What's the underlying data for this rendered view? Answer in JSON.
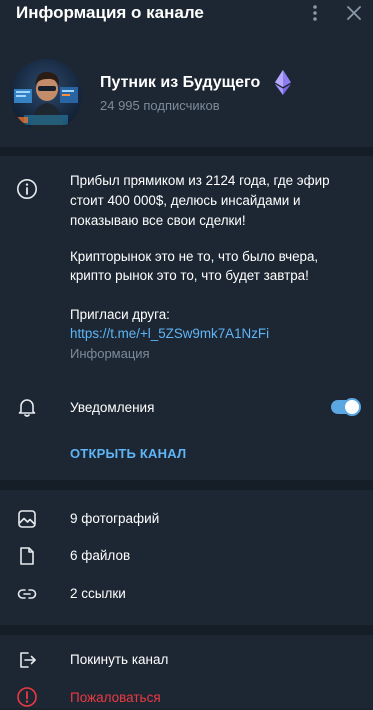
{
  "header": {
    "title": "Информация о канале",
    "more_icon": "more-vertical-icon",
    "close_icon": "close-icon"
  },
  "channel": {
    "name": "Путник из Будущего",
    "badge_icon": "ethereum-icon",
    "subscribers": "24 995 подписчиков"
  },
  "about": {
    "icon": "info-icon",
    "line1": "Прибыл прямиком из 2124 года, где эфир",
    "line2": "стоит 400 000$, делюсь инсайдами и",
    "line3": "показываю все свои сделки!",
    "line4": "Крипторынок это не то, что было вчера,",
    "line5": "крипто рынок это то, что будет завтра!",
    "invite_label": "Пригласи друга:",
    "invite_link": "https://t.me/+l_5ZSw9mk7A1NzFi",
    "caption": "Информация"
  },
  "notifications": {
    "icon": "bell-icon",
    "label": "Уведомления",
    "enabled": true
  },
  "open_channel": {
    "label": "ОТКРЫТЬ КАНАЛ"
  },
  "media": [
    {
      "icon": "photo-icon",
      "label": "9 фотографий"
    },
    {
      "icon": "file-icon",
      "label": "6 файлов"
    },
    {
      "icon": "link-icon",
      "label": "2 ссылки"
    }
  ],
  "actions": {
    "leave": {
      "icon": "leave-icon",
      "label": "Покинуть канал"
    },
    "report": {
      "icon": "report-icon",
      "label": "Пожаловаться"
    }
  },
  "colors": {
    "background": "#1d2733",
    "separator": "#151d26",
    "accent": "#5eb5f7",
    "muted": "#7d8b99",
    "danger": "#ec3942",
    "toggle": "#5aa7e2"
  }
}
